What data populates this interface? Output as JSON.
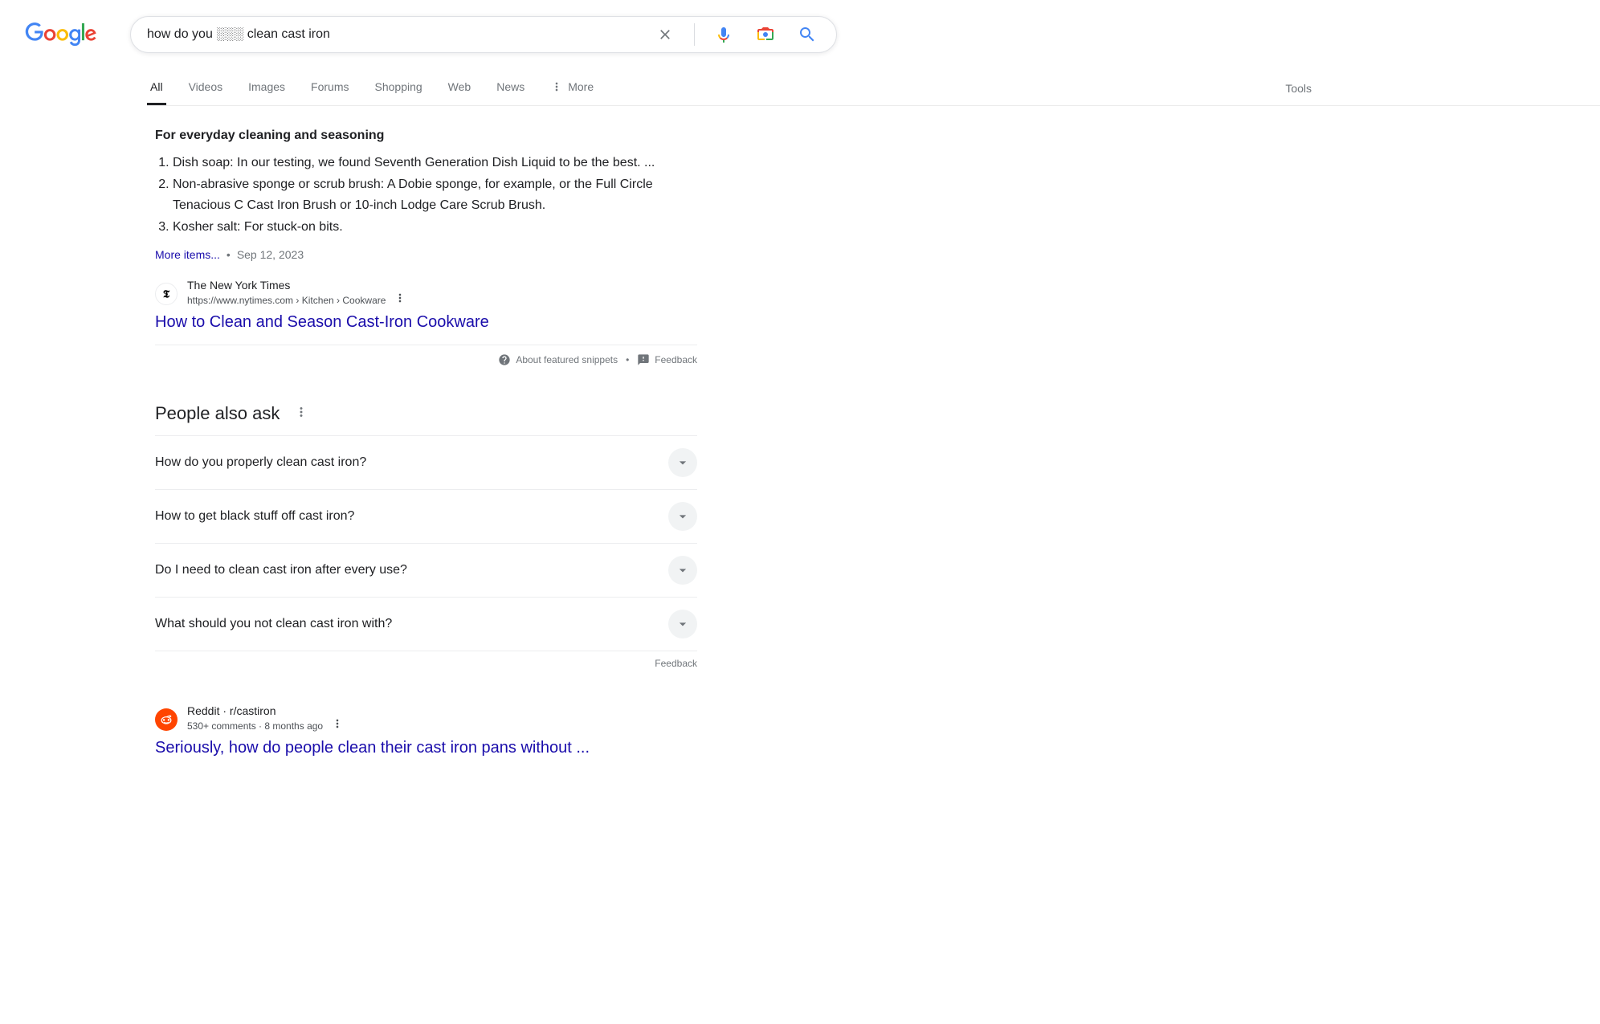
{
  "search": {
    "query": "how do you ░░░ clean cast iron"
  },
  "tabs": [
    "All",
    "Videos",
    "Images",
    "Forums",
    "Shopping",
    "Web",
    "News"
  ],
  "tabs_more": "More",
  "tools_label": "Tools",
  "snippet": {
    "heading": "For everyday cleaning and seasoning",
    "items": [
      "Dish soap: In our testing, we found Seventh Generation Dish Liquid to be the best. ...",
      "Non-abrasive sponge or scrub brush: A Dobie sponge, for example, or the Full Circle Tenacious C Cast Iron Brush or 10-inch Lodge Care Scrub Brush.",
      "Kosher salt: For stuck-on bits."
    ],
    "more": "More items...",
    "date": "Sep 12, 2023",
    "source_name": "The New York Times",
    "source_url": "https://www.nytimes.com › Kitchen › Cookware",
    "title": "How to Clean and Season Cast-Iron Cookware",
    "about": "About featured snippets",
    "feedback": "Feedback"
  },
  "paa": {
    "title": "People also ask",
    "questions": [
      "How do you properly clean cast iron?",
      "How to get black stuff off cast iron?",
      "Do I need to clean cast iron after every use?",
      "What should you not clean cast iron with?"
    ],
    "feedback": "Feedback"
  },
  "result2": {
    "source": "Reddit · r/castiron",
    "meta": "530+ comments · 8 months ago",
    "title": "Seriously, how do people clean their cast iron pans without ..."
  }
}
